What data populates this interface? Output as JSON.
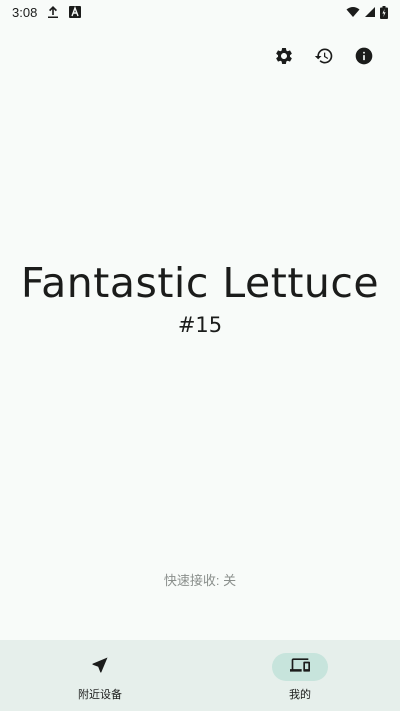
{
  "status_bar": {
    "time": "3:08",
    "icons": [
      "upload-icon",
      "font-a-icon",
      "wifi-icon",
      "signal-icon",
      "battery-charging-icon"
    ]
  },
  "top_actions": {
    "icons": [
      "settings-icon",
      "history-icon",
      "info-icon"
    ]
  },
  "device": {
    "name": "Fantastic Lettuce",
    "number": "#15"
  },
  "quick_receive": {
    "text": "快速接收: 关"
  },
  "bottom_nav": {
    "items": [
      {
        "label": "附近设备",
        "icon": "navigation-arrow-icon",
        "active": false
      },
      {
        "label": "我的",
        "icon": "devices-icon",
        "active": true
      }
    ]
  },
  "colors": {
    "background": "#f8fbf9",
    "nav_background": "#e6efeb",
    "nav_active_pill": "#c7e4dc",
    "text_primary": "#1b1c1b",
    "text_secondary": "#8a8f8c"
  }
}
